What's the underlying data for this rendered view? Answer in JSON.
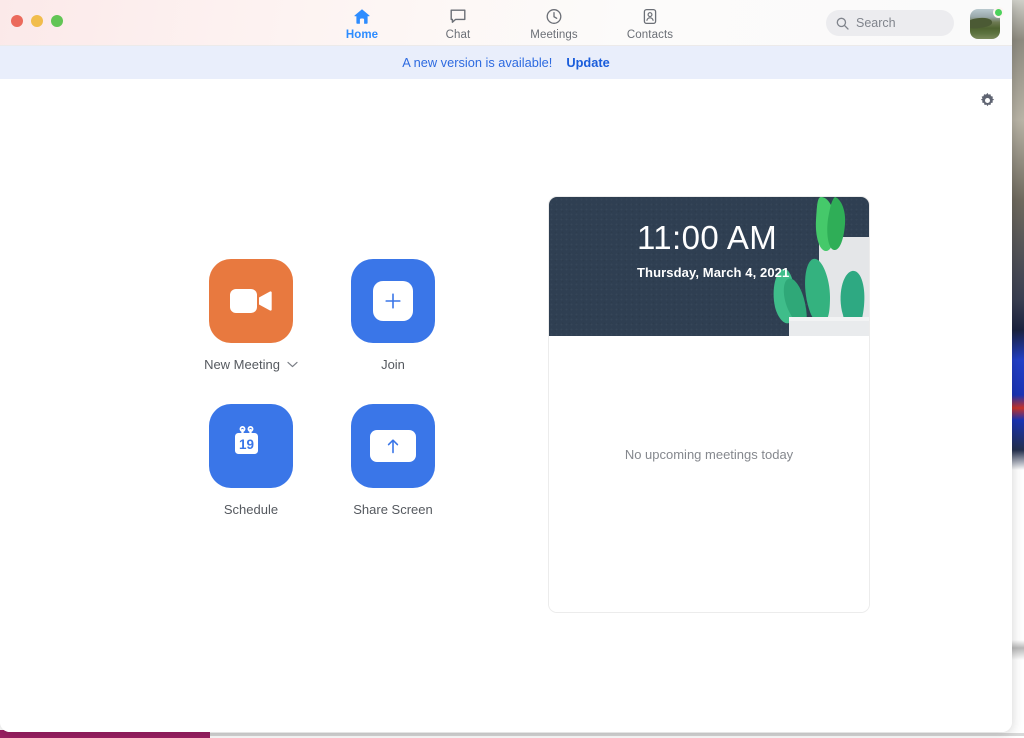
{
  "window": {
    "traffic_lights": [
      "close",
      "minimize",
      "zoom"
    ]
  },
  "nav": {
    "items": [
      {
        "label": "Home",
        "icon": "home-icon",
        "active": true
      },
      {
        "label": "Chat",
        "icon": "chat-icon",
        "active": false
      },
      {
        "label": "Meetings",
        "icon": "clock-icon",
        "active": false
      },
      {
        "label": "Contacts",
        "icon": "contacts-icon",
        "active": false
      }
    ],
    "search": {
      "placeholder": "Search",
      "value": "",
      "icon": "search-icon"
    },
    "avatar": {
      "icon": "avatar",
      "status": "available",
      "status_color": "#4cd15c"
    }
  },
  "banner": {
    "message": "A new version is available!",
    "link_label": "Update",
    "background": "#e9eefb",
    "text_color": "#2d6ae0"
  },
  "content": {
    "settings_icon": "gear-icon",
    "actions": [
      {
        "label": "New Meeting",
        "icon": "video-camera-icon",
        "tile_color": "#e8793f",
        "has_chevron": true
      },
      {
        "label": "Join",
        "icon": "plus-icon",
        "tile_color": "#3a76e8",
        "has_chevron": false
      },
      {
        "label": "Schedule",
        "icon": "calendar-icon",
        "tile_color": "#3a76e8",
        "has_chevron": false,
        "calendar_day": "19"
      },
      {
        "label": "Share Screen",
        "icon": "share-screen-icon",
        "tile_color": "#3a76e8",
        "has_chevron": false
      }
    ],
    "meetings_card": {
      "time": "11:00 AM",
      "date": "Thursday, March 4, 2021",
      "panel_color": "#2f3f52",
      "empty_message": "No upcoming meetings today"
    }
  }
}
